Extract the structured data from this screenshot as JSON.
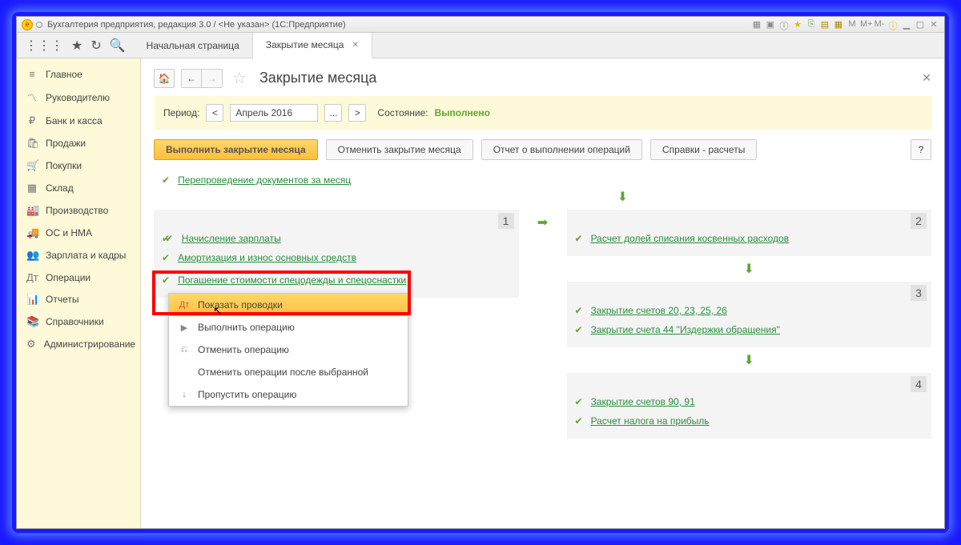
{
  "window_title": "Бухгалтерия предприятия, редакция 3.0 / <Не указан>  (1С:Предприятие)",
  "tabs": {
    "t0": "Начальная страница",
    "t1": "Закрытие месяца"
  },
  "sidebar": {
    "main": "Главное",
    "manager": "Руководителю",
    "bank": "Банк и касса",
    "sales": "Продажи",
    "purchases": "Покупки",
    "stock": "Склад",
    "production": "Производство",
    "assets": "ОС и НМА",
    "salary": "Зарплата и кадры",
    "ops": "Операции",
    "reports": "Отчеты",
    "refs": "Справочники",
    "admin": "Администрирование"
  },
  "page_title": "Закрытие месяца",
  "period_label": "Период:",
  "period_value": "Апрель 2016",
  "period_ellipsis": "...",
  "status_label": "Состояние:",
  "status_value": "Выполнено",
  "buttons": {
    "run": "Выполнить закрытие месяца",
    "cancel": "Отменить закрытие месяца",
    "report": "Отчет о выполнении операций",
    "calc": "Справки - расчеты",
    "help": "?"
  },
  "top_operation": "Перепроведение документов за месяц",
  "stage1": {
    "num": "1",
    "op1": "Начисление зарплаты",
    "op2": "Амортизация и износ основных средств",
    "op3": "Погашение стоимости спецодежды и спецоснастки"
  },
  "stage2": {
    "num": "2",
    "op1": "Расчет долей списания косвенных расходов"
  },
  "stage3": {
    "num": "3",
    "op1": "Закрытие счетов 20, 23, 25, 26",
    "op2": "Закрытие счета 44 \"Издержки обращения\""
  },
  "stage4": {
    "num": "4",
    "op1": "Закрытие счетов 90, 91",
    "op2": "Расчет налога на прибыль"
  },
  "context": {
    "show_entries": "Показать проводки",
    "execute": "Выполнить операцию",
    "cancel_op": "Отменить операцию",
    "cancel_after": "Отменить операции после выбранной",
    "skip": "Пропустить операцию"
  }
}
